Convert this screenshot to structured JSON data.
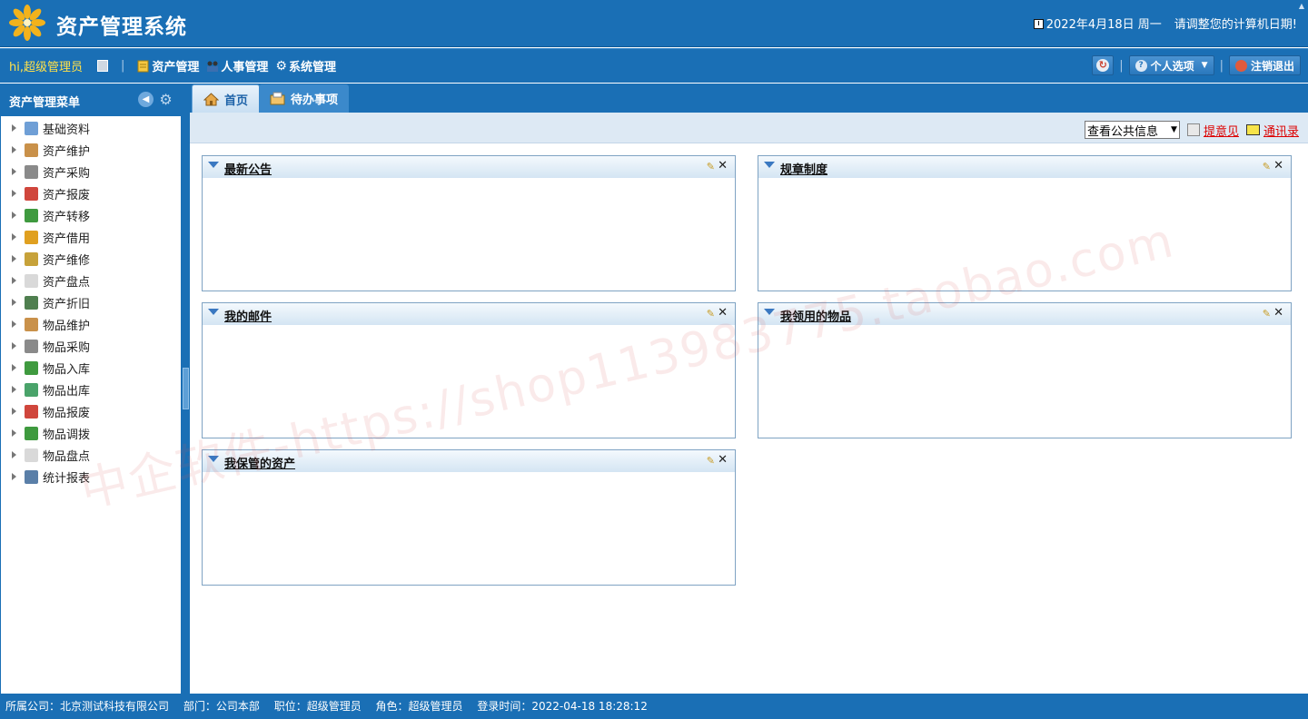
{
  "header": {
    "title": "资产管理系统",
    "date": "2022年4月18日 周一",
    "notice": "请调整您的计算机日期!"
  },
  "navbar": {
    "greeting": "hi,超级管理员",
    "menus": [
      "资产管理",
      "人事管理",
      "系统管理"
    ],
    "personal_options": "个人选项",
    "logout": "注销退出"
  },
  "sidebar": {
    "title": "资产管理菜单",
    "items": [
      {
        "label": "基础资料",
        "color": "#6f9fd6"
      },
      {
        "label": "资产维护",
        "color": "#c9914a"
      },
      {
        "label": "资产采购",
        "color": "#8a8a8a"
      },
      {
        "label": "资产报废",
        "color": "#d0463c"
      },
      {
        "label": "资产转移",
        "color": "#3f9a3f"
      },
      {
        "label": "资产借用",
        "color": "#e0a020"
      },
      {
        "label": "资产维修",
        "color": "#c7a23a"
      },
      {
        "label": "资产盘点",
        "color": "#d9d9d9"
      },
      {
        "label": "资产折旧",
        "color": "#4f7f4f"
      },
      {
        "label": "物品维护",
        "color": "#c9914a"
      },
      {
        "label": "物品采购",
        "color": "#8a8a8a"
      },
      {
        "label": "物品入库",
        "color": "#3f9a3f"
      },
      {
        "label": "物品出库",
        "color": "#4aa36a"
      },
      {
        "label": "物品报废",
        "color": "#d0463c"
      },
      {
        "label": "物品调拨",
        "color": "#3f9a3f"
      },
      {
        "label": "物品盘点",
        "color": "#d9d9d9"
      },
      {
        "label": "统计报表",
        "color": "#5a7fa8"
      }
    ]
  },
  "tabs": [
    {
      "label": "首页"
    },
    {
      "label": "待办事项"
    }
  ],
  "toolbar": {
    "select_value": "查看公共信息",
    "suggest_link": "提意见",
    "contacts_link": "通讯录"
  },
  "portlets": {
    "p1": "最新公告",
    "p2": "规章制度",
    "p3": "我的邮件",
    "p4": "我领用的物品",
    "p5": "我保管的资产"
  },
  "watermark": "中企软件-https://shop113983775.taobao.com",
  "footer": {
    "company": "所属公司：北京测试科技有限公司",
    "dept": "部门：公司本部",
    "position": "职位：超级管理员",
    "role": "角色：超级管理员",
    "login_time": "登录时间：2022-04-18 18:28:12"
  },
  "colors": {
    "primary": "#1a6fb5",
    "accent_yellow": "#ffe14a",
    "link_red": "#dd0000"
  }
}
